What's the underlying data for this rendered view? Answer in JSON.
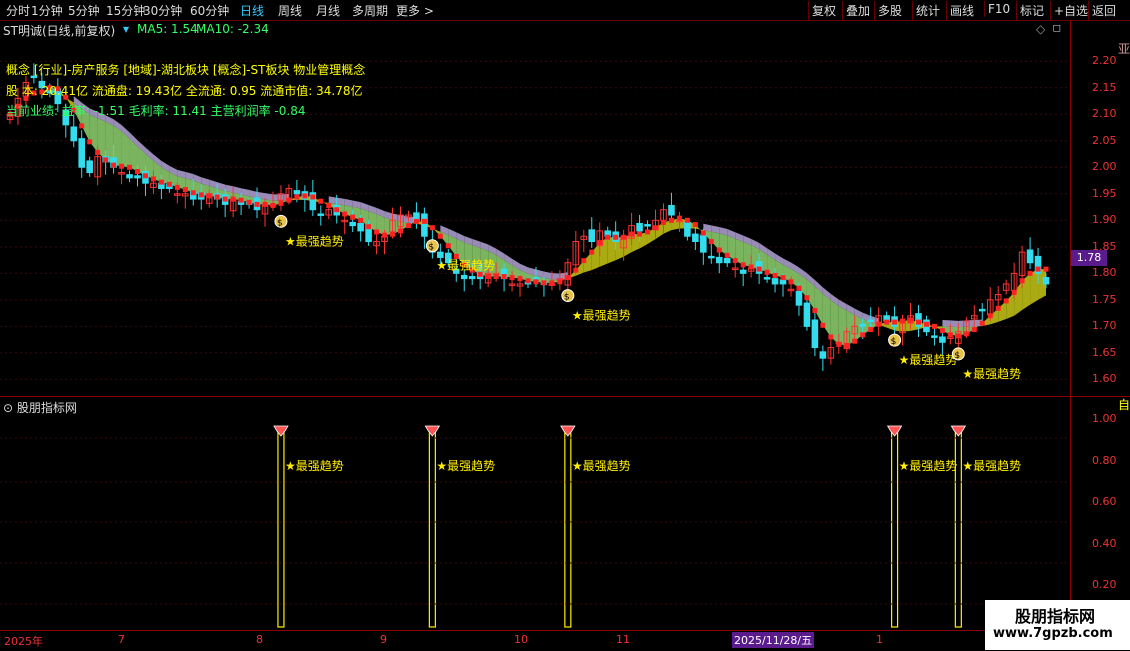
{
  "toolbar": {
    "periods": [
      "分时",
      "1分钟",
      "5分钟",
      "15分钟",
      "30分钟",
      "60分钟",
      "日线",
      "周线",
      "月线",
      "多周期",
      "更多"
    ],
    "active": "日线",
    "right_buttons": [
      "复权",
      "叠加",
      "多股",
      "统计",
      "画线",
      "F10",
      "标记",
      "+自选",
      "返回"
    ]
  },
  "header": {
    "stock": "ST明诚(日线,前复权)",
    "ma5": "MA5: 1.54",
    "ma10": "MA10: -2.34"
  },
  "info": {
    "concept": "概念 [行业]-房产服务 [地域]-湖北板块 [概念]-ST板块 物业管理概念",
    "capital": "股 本: 20.41亿 流通盘: 19.43亿 全流通: 0.95 流通市值: 34.78亿",
    "perf": "当前业绩: 益率: -1.51 毛利率: 11.41 主营利润率 -0.84"
  },
  "signal_label": "★最强趋势",
  "price_axis": [
    "2.20",
    "2.15",
    "2.10",
    "2.05",
    "2.00",
    "1.95",
    "1.90",
    "1.85",
    "1.80",
    "1.75",
    "1.70",
    "1.65",
    "1.60"
  ],
  "current_price": "1.78",
  "sub": {
    "title": "股朋指标网",
    "axis": [
      "1.00",
      "0.80",
      "0.60",
      "0.40",
      "0.20"
    ]
  },
  "dates": [
    "2025年",
    "7",
    "8",
    "9",
    "10",
    "11",
    "1"
  ],
  "cursor_date": "2025/11/28/五",
  "watermark": {
    "title": "股朋指标网",
    "url": "www.7gpzb.com"
  },
  "colors": {
    "up": "#ff3333",
    "down": "#33ddee",
    "signal": "#ffee00",
    "ma_fill_green": "#8fd36f",
    "ma_fill_purple": "#a99ac9"
  },
  "chart_data": {
    "type": "candlestick",
    "signals_index": [
      34,
      53,
      70,
      111,
      119
    ],
    "ylim": [
      1.58,
      2.24
    ],
    "sub_ylim": [
      0,
      1.05
    ],
    "closes": [
      2.1,
      2.13,
      2.16,
      2.17,
      2.15,
      2.14,
      2.12,
      2.08,
      2.05,
      2.0,
      1.99,
      2.02,
      2.01,
      2.0,
      1.99,
      1.98,
      1.98,
      1.97,
      1.97,
      1.96,
      1.96,
      1.95,
      1.95,
      1.94,
      1.94,
      1.95,
      1.94,
      1.93,
      1.94,
      1.93,
      1.93,
      1.92,
      1.93,
      1.93,
      1.95,
      1.96,
      1.95,
      1.94,
      1.92,
      1.91,
      1.92,
      1.91,
      1.9,
      1.89,
      1.88,
      1.86,
      1.86,
      1.87,
      1.9,
      1.91,
      1.91,
      1.9,
      1.87,
      1.84,
      1.83,
      1.82,
      1.8,
      1.79,
      1.79,
      1.79,
      1.8,
      1.8,
      1.79,
      1.78,
      1.78,
      1.78,
      1.79,
      1.78,
      1.78,
      1.79,
      1.82,
      1.86,
      1.87,
      1.86,
      1.88,
      1.87,
      1.86,
      1.87,
      1.89,
      1.88,
      1.89,
      1.9,
      1.92,
      1.91,
      1.9,
      1.87,
      1.86,
      1.84,
      1.83,
      1.82,
      1.82,
      1.81,
      1.8,
      1.81,
      1.8,
      1.79,
      1.78,
      1.78,
      1.77,
      1.74,
      1.7,
      1.66,
      1.64,
      1.66,
      1.67,
      1.69,
      1.7,
      1.7,
      1.71,
      1.72,
      1.71,
      1.7,
      1.71,
      1.72,
      1.7,
      1.69,
      1.68,
      1.67,
      1.68,
      1.69,
      1.71,
      1.72,
      1.73,
      1.75,
      1.76,
      1.78,
      1.8,
      1.84,
      1.82,
      1.8,
      1.78
    ]
  }
}
